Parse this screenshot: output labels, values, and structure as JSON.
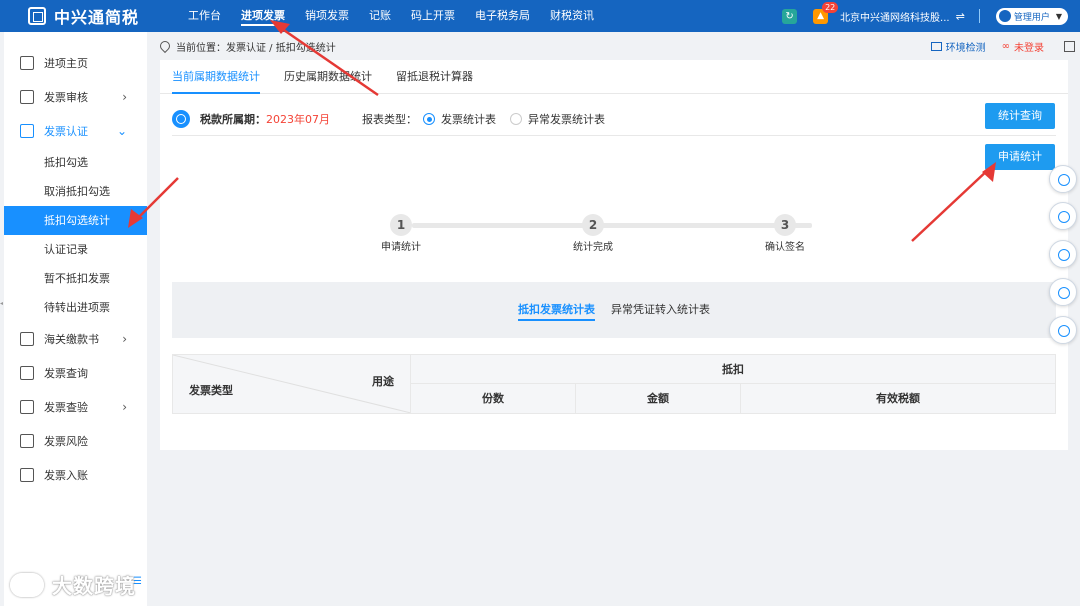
{
  "header": {
    "logo_text": "中兴通简税",
    "nav": [
      "工作台",
      "进项发票",
      "销项发票",
      "记账",
      "码上开票",
      "电子税务局",
      "财税资讯"
    ],
    "active_nav": "进项发票",
    "notification_count": "22",
    "company": "北京中兴通网络科技股...",
    "user": "管理用户"
  },
  "sidebar": {
    "items": [
      {
        "label": "进项主页",
        "icon": "home-icon"
      },
      {
        "label": "发票审核",
        "icon": "edit-icon",
        "chevron": "›"
      },
      {
        "label": "发票认证",
        "icon": "check-icon",
        "chevron": "⌄"
      }
    ],
    "sub_items": [
      "抵扣勾选",
      "取消抵扣勾选",
      "抵扣勾选统计",
      "认证记录",
      "暂不抵扣发票",
      "待转出进项票"
    ],
    "active_sub": "抵扣勾选统计",
    "items_after": [
      {
        "label": "海关缴款书",
        "icon": "document-icon",
        "chevron": "›"
      },
      {
        "label": "发票查询",
        "icon": "grid-icon"
      },
      {
        "label": "发票查验",
        "icon": "search-doc-icon",
        "chevron": "›"
      },
      {
        "label": "发票风险",
        "icon": "chart-icon"
      },
      {
        "label": "发票入账",
        "icon": "ledger-icon"
      }
    ]
  },
  "breadcrumb": {
    "prefix": "当前位置：",
    "path": "发票认证 / 抵扣勾选统计",
    "env_check": "环境检测",
    "login_status": "未登录"
  },
  "tabs": [
    "当前属期数据统计",
    "历史属期数据统计",
    "留抵退税计算器"
  ],
  "active_tab": "当前属期数据统计",
  "filter": {
    "period_label": "税款所属期：",
    "period_value": "2023年07月",
    "type_label": "报表类型：",
    "options": [
      "发票统计表",
      "异常发票统计表"
    ],
    "selected_option": "发票统计表",
    "query_button": "统计查询",
    "apply_button": "申请统计"
  },
  "steps": [
    {
      "num": "1",
      "label": "申请统计"
    },
    {
      "num": "2",
      "label": "统计完成"
    },
    {
      "num": "3",
      "label": "确认签名"
    }
  ],
  "sub_tabs": [
    "抵扣发票统计表",
    "异常凭证转入统计表"
  ],
  "active_sub_tab": "抵扣发票统计表",
  "table": {
    "corner_top": "用途",
    "corner_bottom": "发票类型",
    "group_header": "抵扣",
    "columns": [
      "份数",
      "金额",
      "有效税额"
    ]
  },
  "watermark": "大数跨境",
  "colors": {
    "header_bg": "#1565c0",
    "accent": "#1890ff",
    "button": "#1e9bf0",
    "period_red": "#f44336",
    "arrow_red": "#e53935"
  }
}
